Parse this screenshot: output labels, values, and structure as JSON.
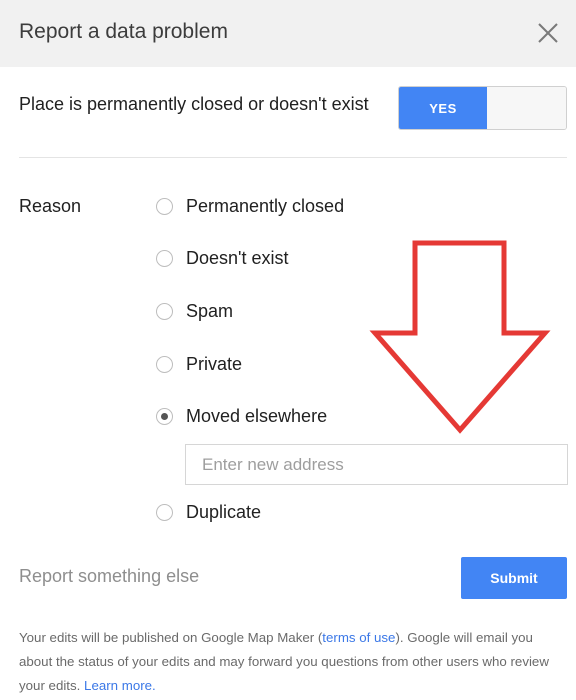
{
  "dialog": {
    "title": "Report a data problem",
    "close_icon": "close-icon"
  },
  "closed_toggle": {
    "label": "Place is permanently closed or doesn't exist",
    "yes_label": "YES"
  },
  "reason": {
    "label": "Reason",
    "options": [
      {
        "label": "Permanently closed",
        "checked": false
      },
      {
        "label": "Doesn't exist",
        "checked": false
      },
      {
        "label": "Spam",
        "checked": false
      },
      {
        "label": "Private",
        "checked": false
      },
      {
        "label": "Moved elsewhere",
        "checked": true
      },
      {
        "label": "Duplicate",
        "checked": false
      }
    ],
    "address_placeholder": "Enter new address",
    "address_value": ""
  },
  "actions": {
    "report_else": "Report something else",
    "submit_label": "Submit"
  },
  "footer": {
    "text_1": "Your edits will be published on Google Map Maker (",
    "terms_link": "terms of use",
    "text_2": "). Google will email you about the status of your edits and may forward you questions from other users who review your edits. ",
    "learn_more": "Learn more."
  },
  "colors": {
    "accent": "#4285f4",
    "annotation": "#e53935"
  }
}
